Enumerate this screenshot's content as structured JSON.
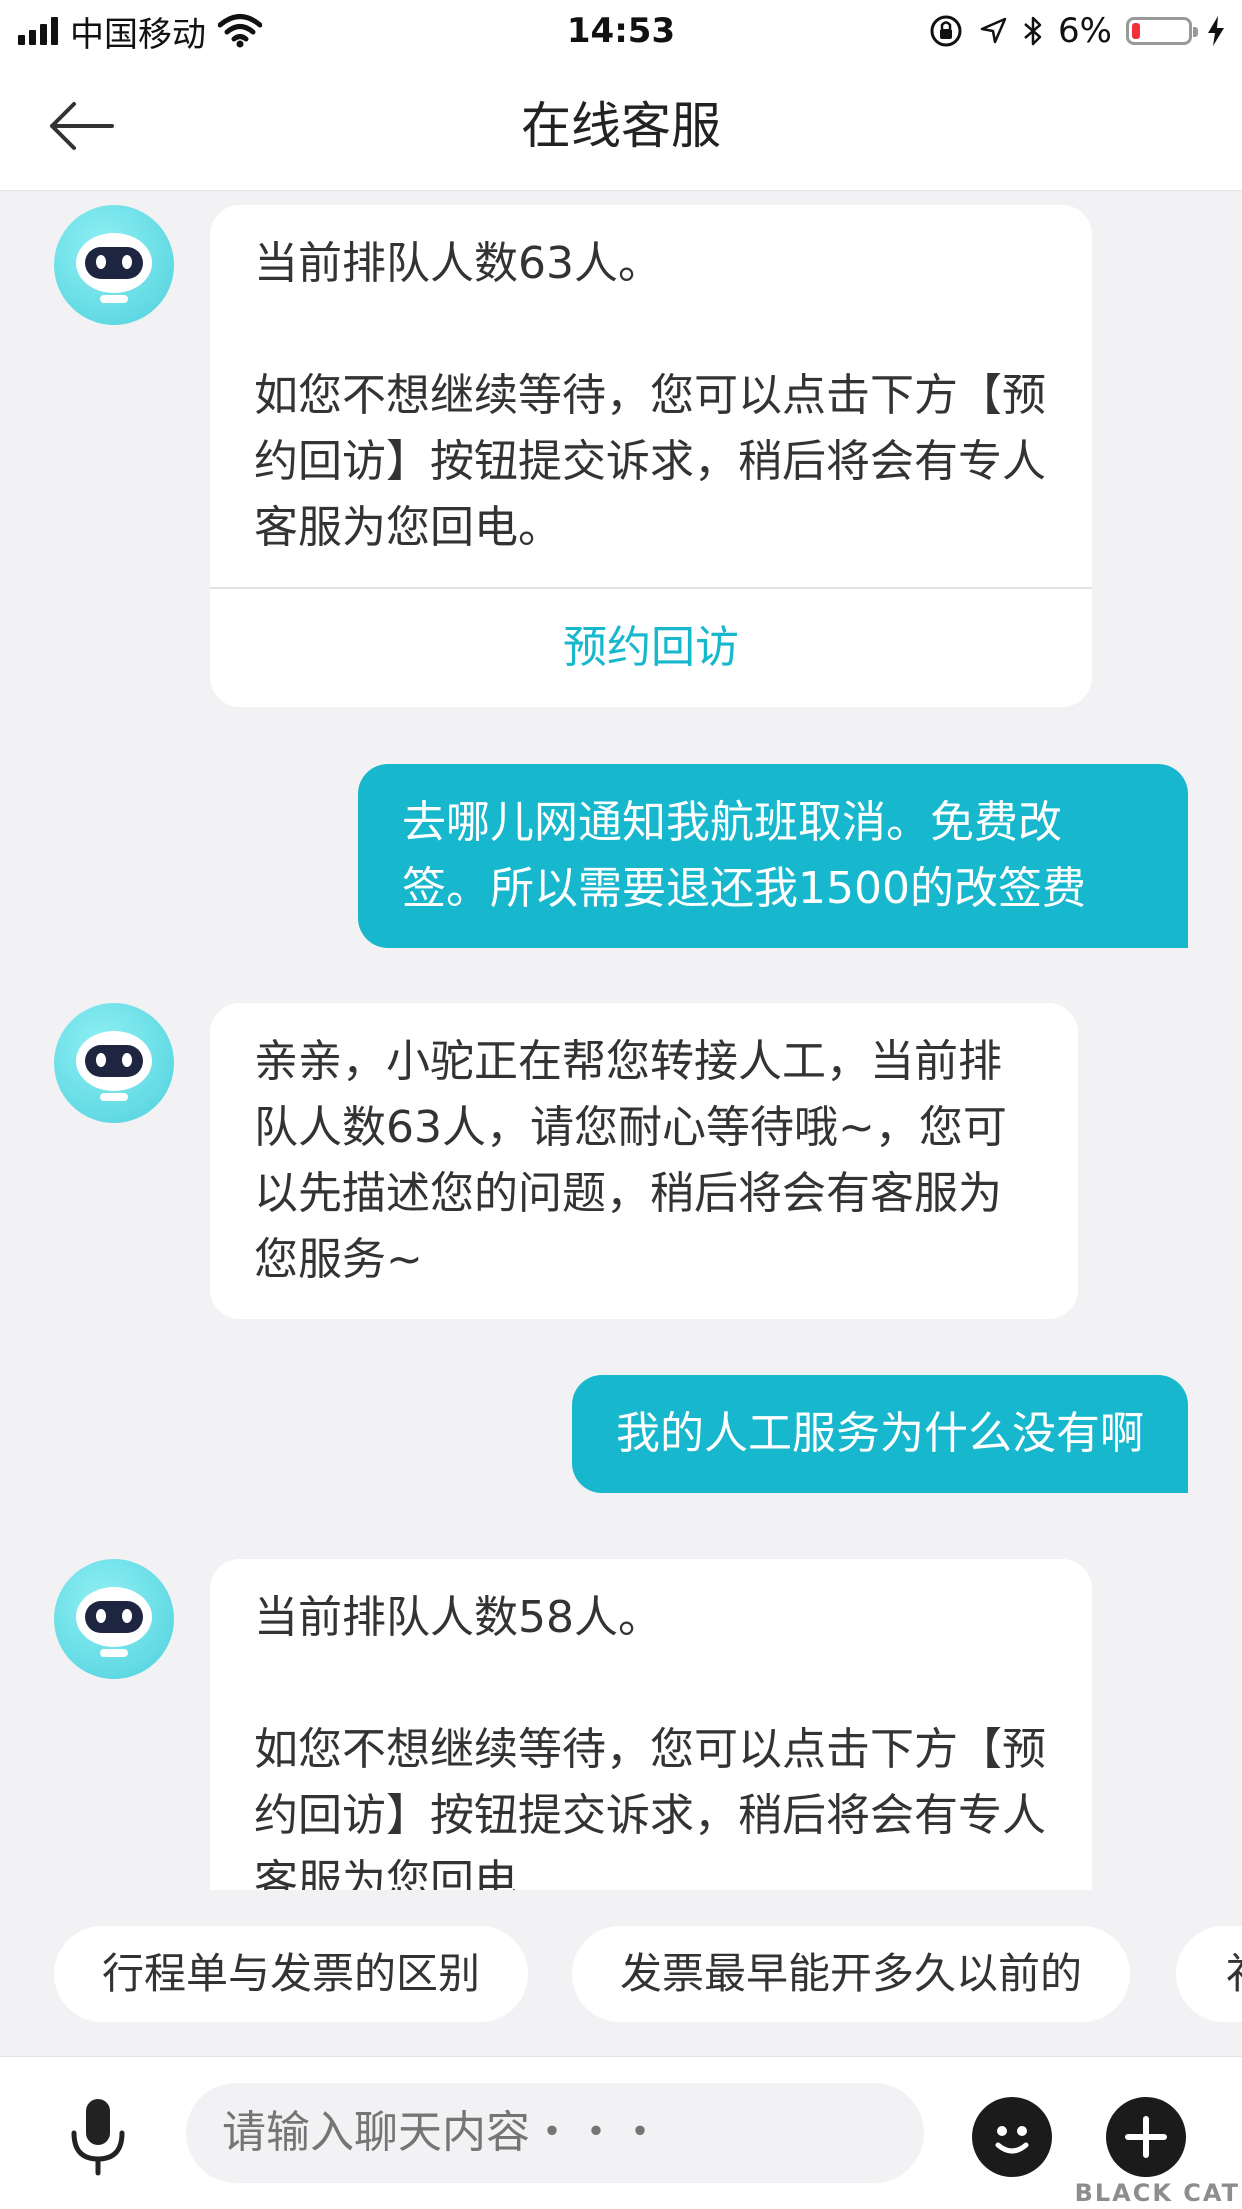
{
  "status_bar": {
    "carrier": "中国移动",
    "time": "14:53",
    "battery": "6%",
    "battery_level": 0.06
  },
  "header": {
    "title": "在线客服",
    "back_icon": "back-arrow-icon"
  },
  "messages": [
    {
      "from": "bot",
      "text": "当前排队人数63人。\n\n如您不想继续等待，您可以点击下方【预约回访】按钮提交诉求，稍后将会有专人客服为您回电。",
      "action": "预约回访"
    },
    {
      "from": "user",
      "text": "去哪儿网通知我航班取消。免费改签。所以需要退还我1500的改签费"
    },
    {
      "from": "bot",
      "text": "亲亲，小驼正在帮您转接人工，当前排队人数63人，请您耐心等待哦~，您可以先描述您的问题，稍后将会有客服为您服务~"
    },
    {
      "from": "user",
      "text": "我的人工服务为什么没有啊"
    },
    {
      "from": "bot",
      "text": "当前排队人数58人。\n\n如您不想继续等待，您可以点击下方【预约回访】按钮提交诉求，稍后将会有专人客服为您回电"
    }
  ],
  "quick_replies": [
    "行程单与发票的区别",
    "发票最早能开多久以前的",
    "补"
  ],
  "input": {
    "placeholder": "请输入聊天内容・・・",
    "value": ""
  },
  "watermark": "BLACK CAT",
  "colors": {
    "accent": "#17b7cd",
    "background": "#f2f2f4",
    "bubble_bot": "#ffffff",
    "battery_low": "#f0303a"
  }
}
